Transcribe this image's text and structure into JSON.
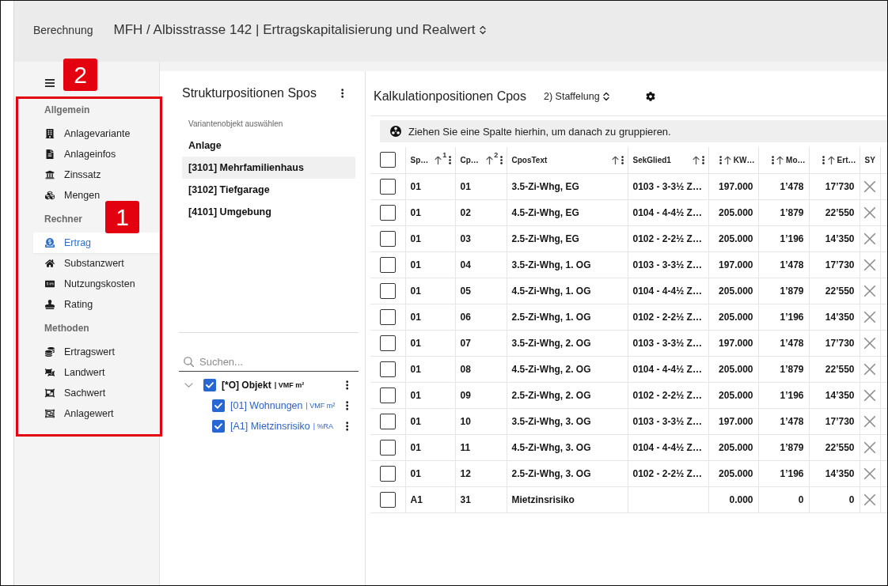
{
  "header": {
    "breadcrumb": "Berechnung",
    "title": "MFH / Albisstrasse 142 | Ertragskapitalisierung und Realwert"
  },
  "sidebar": {
    "sections": [
      {
        "title": "Allgemein",
        "items": [
          {
            "label": "Anlagevariante",
            "selected": false
          },
          {
            "label": "Anlageinfos",
            "selected": false
          },
          {
            "label": "Zinssatz",
            "selected": false
          },
          {
            "label": "Mengen",
            "selected": false
          }
        ]
      },
      {
        "title": "Rechner",
        "items": [
          {
            "label": "Ertrag",
            "selected": true
          },
          {
            "label": "Substanzwert",
            "selected": false
          },
          {
            "label": "Nutzungskosten",
            "selected": false
          },
          {
            "label": "Rating",
            "selected": false
          }
        ]
      },
      {
        "title": "Methoden",
        "items": [
          {
            "label": "Ertragswert",
            "selected": false
          },
          {
            "label": "Landwert",
            "selected": false
          },
          {
            "label": "Sachwert",
            "selected": false
          },
          {
            "label": "Anlagewert",
            "selected": false
          }
        ]
      }
    ]
  },
  "annotations": [
    {
      "label": "2"
    },
    {
      "label": "1"
    }
  ],
  "structure_panel": {
    "title": "Strukturpositionen Spos",
    "subtitle": "Variantenobjekt auswählen",
    "items": [
      {
        "label": "Anlage",
        "selected": false
      },
      {
        "label": "[3101] Mehrfamilienhaus",
        "selected": true
      },
      {
        "label": "[3102] Tiefgarage",
        "selected": false
      },
      {
        "label": "[4101] Umgebung",
        "selected": false
      }
    ],
    "search": {
      "placeholder": "Suchen..."
    },
    "tree": [
      {
        "label": "[*O] Objekt",
        "unit": "| VMF m²",
        "checked": true,
        "expanded": true,
        "children": [
          {
            "label": "[01] Wohnungen",
            "unit": "| VMF m²",
            "checked": true
          },
          {
            "label": "[A1] Mietzinsrisiko",
            "unit": "| %RA",
            "checked": true
          }
        ]
      }
    ]
  },
  "calc_panel": {
    "title": "Kalkulationpositionen Cpos",
    "variant": "2) Staffelung",
    "group_hint": "Ziehen Sie eine Spalte hierhin, um danach zu gruppieren.",
    "table": {
      "header_checked": false,
      "columns": [
        {
          "label": "Sp…",
          "kind": "text",
          "sort_order": "1"
        },
        {
          "label": "Cp…",
          "kind": "text",
          "sort_order": "2"
        },
        {
          "label": "CposText",
          "kind": "text"
        },
        {
          "label": "SekGlied1",
          "kind": "text"
        },
        {
          "label": "KW…",
          "kind": "number"
        },
        {
          "label": "Mo…",
          "kind": "number"
        },
        {
          "label": "Ert…",
          "kind": "number"
        },
        {
          "label": "SY",
          "kind": "flag"
        }
      ],
      "rows": [
        {
          "checked": false,
          "sy": false,
          "cells": [
            "01",
            "01",
            "3.5-Zi-Whg, EG",
            "0103 - 3-3½ Z…",
            "197.000",
            "1’478",
            "17’730"
          ]
        },
        {
          "checked": false,
          "sy": false,
          "cells": [
            "01",
            "02",
            "4.5-Zi-Whg, EG",
            "0104 - 4-4½ Z…",
            "205.000",
            "1’879",
            "22’550"
          ]
        },
        {
          "checked": false,
          "sy": false,
          "cells": [
            "01",
            "03",
            "2.5-Zi-Whg, EG",
            "0102 - 2-2½ Z…",
            "205.000",
            "1’196",
            "14’350"
          ]
        },
        {
          "checked": false,
          "sy": false,
          "cells": [
            "01",
            "04",
            "3.5-Zi-Whg, 1. OG",
            "0103 - 3-3½ Z…",
            "197.000",
            "1’478",
            "17’730"
          ]
        },
        {
          "checked": false,
          "sy": false,
          "cells": [
            "01",
            "05",
            "4.5-Zi-Whg, 1. OG",
            "0104 - 4-4½ Z…",
            "205.000",
            "1’879",
            "22’550"
          ]
        },
        {
          "checked": false,
          "sy": false,
          "cells": [
            "01",
            "06",
            "2.5-Zi-Whg, 1. OG",
            "0102 - 2-2½ Z…",
            "205.000",
            "1’196",
            "14’350"
          ]
        },
        {
          "checked": false,
          "sy": false,
          "cells": [
            "01",
            "07",
            "3.5-Zi-Whg, 2. OG",
            "0103 - 3-3½ Z…",
            "197.000",
            "1’478",
            "17’730"
          ]
        },
        {
          "checked": false,
          "sy": false,
          "cells": [
            "01",
            "08",
            "4.5-Zi-Whg, 2. OG",
            "0104 - 4-4½ Z…",
            "205.000",
            "1’879",
            "22’550"
          ]
        },
        {
          "checked": false,
          "sy": false,
          "cells": [
            "01",
            "09",
            "2.5-Zi-Whg, 2. OG",
            "0102 - 2-2½ Z…",
            "205.000",
            "1’196",
            "14’350"
          ]
        },
        {
          "checked": false,
          "sy": false,
          "cells": [
            "01",
            "10",
            "3.5-Zi-Whg, 3. OG",
            "0103 - 3-3½ Z…",
            "197.000",
            "1’478",
            "17’730"
          ]
        },
        {
          "checked": false,
          "sy": false,
          "cells": [
            "01",
            "11",
            "4.5-Zi-Whg, 3. OG",
            "0104 - 4-4½ Z…",
            "205.000",
            "1’879",
            "22’550"
          ]
        },
        {
          "checked": false,
          "sy": false,
          "cells": [
            "01",
            "12",
            "2.5-Zi-Whg, 3. OG",
            "0102 - 2-2½ Z…",
            "205.000",
            "1’196",
            "14’350"
          ]
        },
        {
          "checked": false,
          "sy": false,
          "cells": [
            "A1",
            "31",
            "Mietzinsrisiko",
            null,
            "0.000",
            "0",
            "0"
          ]
        }
      ]
    }
  }
}
